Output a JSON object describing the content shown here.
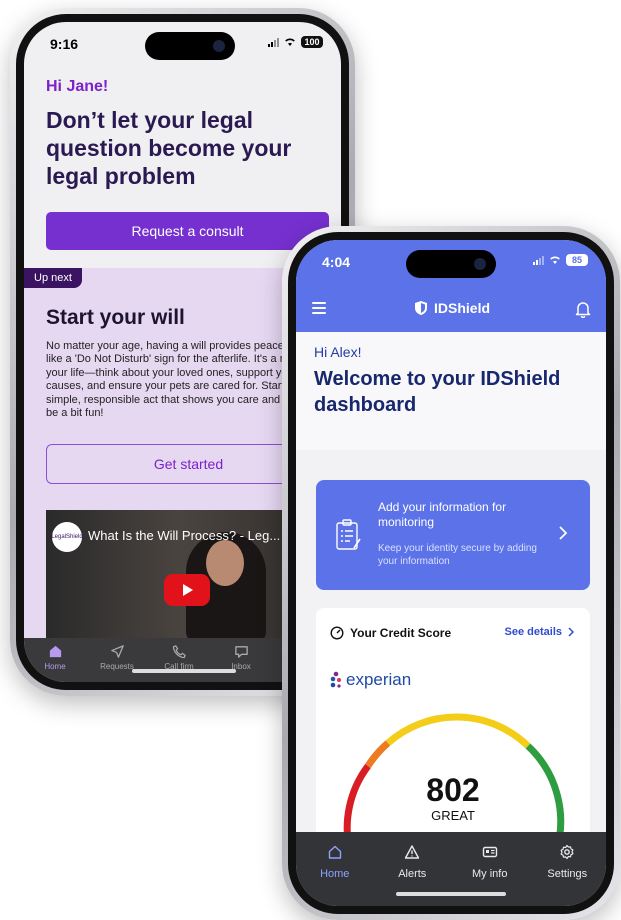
{
  "legal_phone": {
    "status": {
      "time": "9:16",
      "battery": "100"
    },
    "greeting": "Hi Jane!",
    "headline": "Don’t let your legal question become your legal problem",
    "consult_button": "Request a consult",
    "up_next_tag": "Up next",
    "will": {
      "title": "Start your will",
      "body": "No matter your age, having a will provides peace of mind... like a 'Do Not Disturb' sign for the afterlife. It's a reflection of your life—think about your loved ones, support your favorite causes, and ensure your pets are cared for. Start today; it's a simple, responsible act that shows you care and might even be a bit fun!",
      "button": "Get started"
    },
    "video": {
      "channel_logo": "LegalShield",
      "title": "What Is the Will Process? - Leg..."
    },
    "nav": [
      {
        "label": "Home",
        "icon": "home-icon",
        "active": true
      },
      {
        "label": "Requests",
        "icon": "send-icon",
        "active": false
      },
      {
        "label": "Call firm",
        "icon": "phone-icon",
        "active": false
      },
      {
        "label": "Inbox",
        "icon": "inbox-icon",
        "active": false
      }
    ],
    "colors": {
      "accent": "#7630cf",
      "panel": "#e7d8f2",
      "dark": "#3a1462"
    }
  },
  "idshield_phone": {
    "status": {
      "time": "4:04",
      "battery": "85"
    },
    "brand": "IDShield",
    "greeting": "Hi Alex!",
    "headline": "Welcome to your IDShield dashboard",
    "add_card": {
      "title": "Add your information for monitoring",
      "subtitle": "Keep your identity secure by adding your information"
    },
    "credit": {
      "title": "Your Credit Score",
      "link": "See details",
      "bureau": "experian",
      "score": "802",
      "rating": "GREAT"
    },
    "nav": [
      {
        "label": "Home",
        "icon": "home-icon",
        "active": true
      },
      {
        "label": "Alerts",
        "icon": "alert-icon",
        "active": false
      },
      {
        "label": "My info",
        "icon": "id-card-icon",
        "active": false
      },
      {
        "label": "Settings",
        "icon": "gear-icon",
        "active": false
      }
    ],
    "colors": {
      "brand": "#5b72e8",
      "heading": "#17286e",
      "link": "#2f4bd0"
    }
  }
}
